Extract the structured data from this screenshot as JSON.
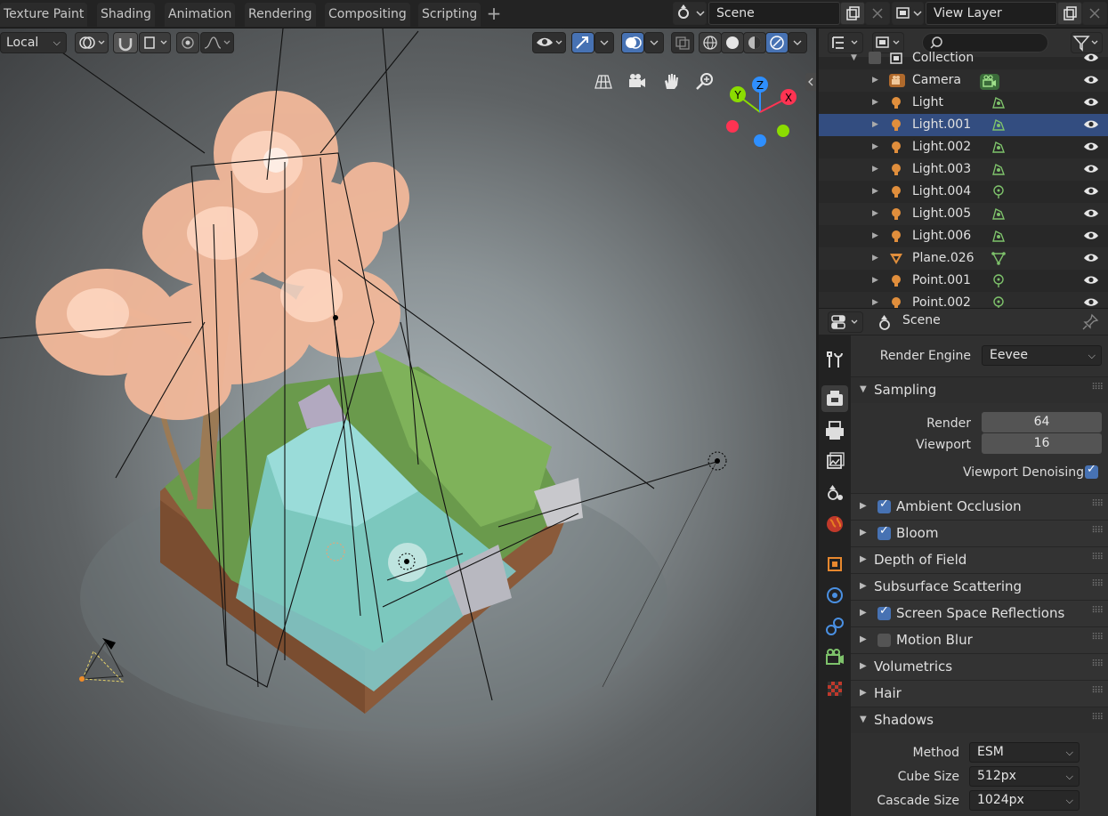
{
  "workspaces": [
    "Texture Paint",
    "Shading",
    "Animation",
    "Rendering",
    "Compositing",
    "Scripting"
  ],
  "header": {
    "scene": "Scene",
    "view_layer": "View Layer"
  },
  "viewport": {
    "transform_orientation": "Local"
  },
  "gizmo": {
    "x": "X",
    "y": "Y",
    "z": "Z"
  },
  "outliner": {
    "rows": [
      {
        "name": "Collection",
        "type": "collection",
        "data": "",
        "selected": false
      },
      {
        "name": "Camera",
        "type": "camera",
        "data": "camera",
        "selected": false
      },
      {
        "name": "Light",
        "type": "light",
        "data": "area",
        "selected": false
      },
      {
        "name": "Light.001",
        "type": "light",
        "data": "area",
        "selected": true
      },
      {
        "name": "Light.002",
        "type": "light",
        "data": "area",
        "selected": false
      },
      {
        "name": "Light.003",
        "type": "light",
        "data": "area",
        "selected": false
      },
      {
        "name": "Light.004",
        "type": "light",
        "data": "point",
        "selected": false
      },
      {
        "name": "Light.005",
        "type": "light",
        "data": "area",
        "selected": false
      },
      {
        "name": "Light.006",
        "type": "light",
        "data": "area",
        "selected": false
      },
      {
        "name": "Plane.026",
        "type": "mesh",
        "data": "mesh",
        "selected": false
      },
      {
        "name": "Point.001",
        "type": "light",
        "data": "point",
        "selected": false
      },
      {
        "name": "Point.002",
        "type": "light",
        "data": "point",
        "selected": false
      }
    ]
  },
  "properties": {
    "context": "Scene",
    "render_engine_label": "Render Engine",
    "render_engine": "Eevee",
    "sampling": {
      "title": "Sampling",
      "render_label": "Render",
      "render": "64",
      "viewport_label": "Viewport",
      "viewport": "16",
      "denoise_label": "Viewport Denoising"
    },
    "panels": [
      {
        "title": "Ambient Occlusion",
        "checkbox": true,
        "checked": true
      },
      {
        "title": "Bloom",
        "checkbox": true,
        "checked": true
      },
      {
        "title": "Depth of Field",
        "checkbox": false,
        "checked": false
      },
      {
        "title": "Subsurface Scattering",
        "checkbox": false,
        "checked": false
      },
      {
        "title": "Screen Space Reflections",
        "checkbox": true,
        "checked": true
      },
      {
        "title": "Motion Blur",
        "checkbox": true,
        "checked": false
      },
      {
        "title": "Volumetrics",
        "checkbox": false,
        "checked": false
      },
      {
        "title": "Hair",
        "checkbox": false,
        "checked": false
      },
      {
        "title": "Shadows",
        "checkbox": false,
        "checked": false,
        "open": true
      }
    ],
    "shadows": {
      "method_label": "Method",
      "method": "ESM",
      "cube_label": "Cube Size",
      "cube": "512px",
      "cascade_label": "Cascade Size",
      "cascade": "1024px"
    }
  },
  "colors": {
    "accent": "#4772b3",
    "selected_row": "#334d80",
    "light_icon": "#e08e3c",
    "data_green": "#7ec26b"
  }
}
